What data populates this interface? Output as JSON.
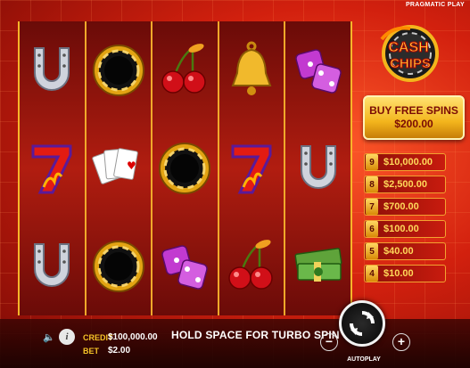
{
  "provider": "PRAGMATIC PLAY",
  "logo": {
    "line1": "CASH",
    "line2": "CHIPS"
  },
  "buy_feature": {
    "title": "BUY FREE SPINS",
    "price": "$200.00"
  },
  "paytable": [
    {
      "count": "9",
      "amount": "$10,000.00"
    },
    {
      "count": "8",
      "amount": "$2,500.00"
    },
    {
      "count": "7",
      "amount": "$700.00"
    },
    {
      "count": "6",
      "amount": "$100.00"
    },
    {
      "count": "5",
      "amount": "$40.00"
    },
    {
      "count": "4",
      "amount": "$10.00"
    }
  ],
  "reels": [
    [
      "horseshoe",
      "seven",
      "horseshoe"
    ],
    [
      "chip",
      "cards",
      "chip"
    ],
    [
      "cherries",
      "chip",
      "dice"
    ],
    [
      "bell",
      "seven",
      "cherries"
    ],
    [
      "dice",
      "horseshoe",
      "cash"
    ]
  ],
  "status": {
    "credit_label": "CREDIT",
    "credit_value": "$100,000.00",
    "bet_label": "BET",
    "bet_value": "$2.00",
    "message": "HOLD SPACE FOR TURBO SPIN"
  },
  "controls": {
    "minus": "−",
    "plus": "+",
    "autoplay": "AUTOPLAY",
    "info": "i"
  },
  "colors": {
    "gold": "#f6c327",
    "reel_border": "#f0a82a",
    "background": "#d2200e"
  }
}
